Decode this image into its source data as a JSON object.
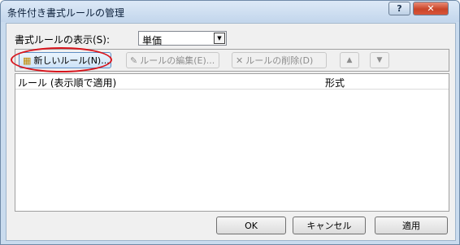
{
  "window": {
    "title": "条件付き書式ルールの管理",
    "help_label": "?",
    "close_label": "✕"
  },
  "show_rules": {
    "label": "書式ルールの表示(S):",
    "value": "単価"
  },
  "toolbar": {
    "new_rule": "新しいルール(N)...",
    "edit_rule": "ルールの編集(E)...",
    "delete_rule": "ルールの削除(D)",
    "move_up": "▲",
    "move_down": "▼"
  },
  "list": {
    "columns": [
      "ルール (表示順で適用)",
      "形式"
    ]
  },
  "buttons": {
    "ok": "OK",
    "cancel": "キャンセル",
    "apply": "適用"
  },
  "icons": {
    "new_rule": "new-rule-icon",
    "edit_rule": "edit-rule-icon",
    "delete_rule": "delete-icon"
  },
  "colors": {
    "highlight": "#d8141c",
    "title_bar": "#c9dbee"
  }
}
